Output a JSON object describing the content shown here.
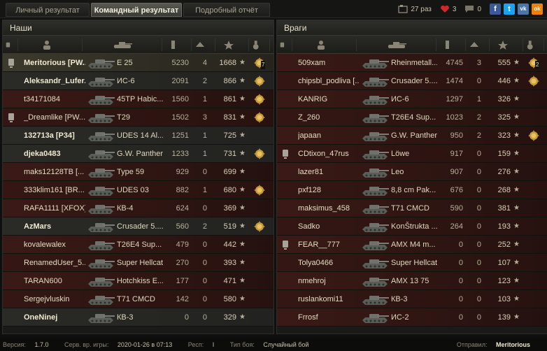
{
  "tabs": [
    {
      "label": "Личный результат",
      "active": false
    },
    {
      "label": "Командный результат",
      "active": true
    },
    {
      "label": "Подробный отчёт",
      "active": false
    }
  ],
  "stats": {
    "views": "27 раз",
    "likes": "3",
    "comments": "0"
  },
  "share": {
    "facebook": "f",
    "twitter": "t",
    "vk": "vk",
    "ok": "ok"
  },
  "panels": {
    "allies": {
      "title": "Наши",
      "rows": [
        {
          "name": "Meritorious [PW...",
          "vehicle": "E 25",
          "damage": "5230",
          "kills": "4",
          "xp": "1668",
          "style": "gold",
          "platoon": true,
          "medal": true,
          "medal_count": "7"
        },
        {
          "name": "Aleksandr_Lufer...",
          "vehicle": "ИС-6",
          "damage": "2091",
          "kills": "2",
          "xp": "866",
          "style": "dark",
          "platoon": false,
          "medal": true,
          "medal_count": ""
        },
        {
          "name": "t34171084",
          "vehicle": "45TP Habic...",
          "damage": "1560",
          "kills": "1",
          "xp": "861",
          "style": "red",
          "platoon": false,
          "medal": true,
          "medal_count": ""
        },
        {
          "name": "_Dreamlike [PW...",
          "vehicle": "T29",
          "damage": "1502",
          "kills": "3",
          "xp": "831",
          "style": "red2",
          "platoon": true,
          "medal": true,
          "medal_count": ""
        },
        {
          "name": "132713a [P34]",
          "vehicle": "UDES 14 Al...",
          "damage": "1251",
          "kills": "1",
          "xp": "725",
          "style": "dark",
          "platoon": false,
          "medal": false,
          "medal_count": ""
        },
        {
          "name": "djeka0483",
          "vehicle": "G.W. Panther",
          "damage": "1233",
          "kills": "1",
          "xp": "731",
          "style": "dark",
          "platoon": false,
          "medal": true,
          "medal_count": ""
        },
        {
          "name": "maks12128TB [...",
          "vehicle": "Type 59",
          "damage": "929",
          "kills": "0",
          "xp": "699",
          "style": "red",
          "platoon": false,
          "medal": false,
          "medal_count": ""
        },
        {
          "name": "333klim161 [BR...",
          "vehicle": "UDES 03",
          "damage": "882",
          "kills": "1",
          "xp": "680",
          "style": "red2",
          "platoon": false,
          "medal": true,
          "medal_count": ""
        },
        {
          "name": "RAFA1111 [XFOX]",
          "vehicle": "КВ-4",
          "damage": "624",
          "kills": "0",
          "xp": "369",
          "style": "red",
          "platoon": false,
          "medal": false,
          "medal_count": ""
        },
        {
          "name": "AzMars",
          "vehicle": "Crusader 5....",
          "damage": "560",
          "kills": "2",
          "xp": "519",
          "style": "dark",
          "platoon": false,
          "medal": true,
          "medal_count": ""
        },
        {
          "name": "kovalewalex",
          "vehicle": "T26E4 Sup...",
          "damage": "479",
          "kills": "0",
          "xp": "442",
          "style": "red",
          "platoon": false,
          "medal": false,
          "medal_count": ""
        },
        {
          "name": "RenamedUser_5...",
          "vehicle": "Super Hellcat",
          "damage": "270",
          "kills": "0",
          "xp": "393",
          "style": "red2",
          "platoon": false,
          "medal": false,
          "medal_count": ""
        },
        {
          "name": "TARAN600",
          "vehicle": "Hotchkiss E...",
          "damage": "177",
          "kills": "0",
          "xp": "471",
          "style": "red",
          "platoon": false,
          "medal": false,
          "medal_count": ""
        },
        {
          "name": "Sergejvluskin",
          "vehicle": "T71 CMCD",
          "damage": "142",
          "kills": "0",
          "xp": "580",
          "style": "red2",
          "platoon": false,
          "medal": false,
          "medal_count": ""
        },
        {
          "name": "OneNinej",
          "vehicle": "КВ-3",
          "damage": "0",
          "kills": "0",
          "xp": "329",
          "style": "dark",
          "platoon": false,
          "medal": false,
          "medal_count": ""
        }
      ]
    },
    "enemies": {
      "title": "Враги",
      "rows": [
        {
          "name": "509xam",
          "vehicle": "Rheinmetall...",
          "damage": "4745",
          "kills": "3",
          "xp": "555",
          "style": "red",
          "platoon": false,
          "medal": true,
          "medal_count": "2"
        },
        {
          "name": "chipsbl_podliva [...",
          "vehicle": "Crusader 5....",
          "damage": "1474",
          "kills": "0",
          "xp": "446",
          "style": "red2",
          "platoon": false,
          "medal": true,
          "medal_count": ""
        },
        {
          "name": "KANRIG",
          "vehicle": "ИС-6",
          "damage": "1297",
          "kills": "1",
          "xp": "326",
          "style": "red",
          "platoon": false,
          "medal": false,
          "medal_count": ""
        },
        {
          "name": "Z_260",
          "vehicle": "T26E4 Sup...",
          "damage": "1023",
          "kills": "2",
          "xp": "325",
          "style": "red2",
          "platoon": false,
          "medal": false,
          "medal_count": ""
        },
        {
          "name": "japaan",
          "vehicle": "G.W. Panther",
          "damage": "950",
          "kills": "2",
          "xp": "323",
          "style": "red",
          "platoon": false,
          "medal": true,
          "medal_count": ""
        },
        {
          "name": "CDtixon_47rus",
          "vehicle": "Löwe",
          "damage": "917",
          "kills": "0",
          "xp": "159",
          "style": "red2",
          "platoon": true,
          "medal": false,
          "medal_count": ""
        },
        {
          "name": "lazer81",
          "vehicle": "Leo",
          "damage": "907",
          "kills": "0",
          "xp": "276",
          "style": "red",
          "platoon": false,
          "medal": false,
          "medal_count": ""
        },
        {
          "name": "pxf128",
          "vehicle": "8,8 cm Pak...",
          "damage": "676",
          "kills": "0",
          "xp": "268",
          "style": "red2",
          "platoon": false,
          "medal": false,
          "medal_count": ""
        },
        {
          "name": "maksimus_458",
          "vehicle": "T71 CMCD",
          "damage": "590",
          "kills": "0",
          "xp": "381",
          "style": "red",
          "platoon": false,
          "medal": false,
          "medal_count": ""
        },
        {
          "name": "Sadko",
          "vehicle": "KonŠtrukta ...",
          "damage": "264",
          "kills": "0",
          "xp": "193",
          "style": "red2",
          "platoon": false,
          "medal": false,
          "medal_count": ""
        },
        {
          "name": "FEAR__777",
          "vehicle": "AMX M4 m...",
          "damage": "0",
          "kills": "0",
          "xp": "252",
          "style": "red",
          "platoon": true,
          "medal": false,
          "medal_count": ""
        },
        {
          "name": "Tolya0466",
          "vehicle": "Super Hellcat",
          "damage": "0",
          "kills": "0",
          "xp": "107",
          "style": "red2",
          "platoon": false,
          "medal": false,
          "medal_count": ""
        },
        {
          "name": "nmehroj",
          "vehicle": "AMX 13 75",
          "damage": "0",
          "kills": "0",
          "xp": "123",
          "style": "red",
          "platoon": false,
          "medal": false,
          "medal_count": ""
        },
        {
          "name": "ruslankomi11",
          "vehicle": "КВ-3",
          "damage": "0",
          "kills": "0",
          "xp": "103",
          "style": "red2",
          "platoon": false,
          "medal": false,
          "medal_count": ""
        },
        {
          "name": "Frrosf",
          "vehicle": "ИС-2",
          "damage": "0",
          "kills": "0",
          "xp": "139",
          "style": "red",
          "platoon": false,
          "medal": false,
          "medal_count": ""
        }
      ]
    }
  },
  "footer": {
    "version_label": "Версия:",
    "version": "1.7.0",
    "server_label": "Серв. вр. игры:",
    "server_time": "2020-01-26 в 07:13",
    "resp_label": "Респ:",
    "resp": "I",
    "battle_label": "Тип боя:",
    "battle_type": "Случайный бой",
    "sender_label": "Отправил:",
    "sender": "Meritorious"
  },
  "star_glyph": "★",
  "colors": {
    "accent": "#e8e2cc",
    "ally_row": "#3c3a2c",
    "enemy_row": "#3a1a16",
    "facebook": "#3b5998",
    "twitter": "#1da1f2",
    "vk": "#4a76a8",
    "ok": "#ee8208"
  }
}
